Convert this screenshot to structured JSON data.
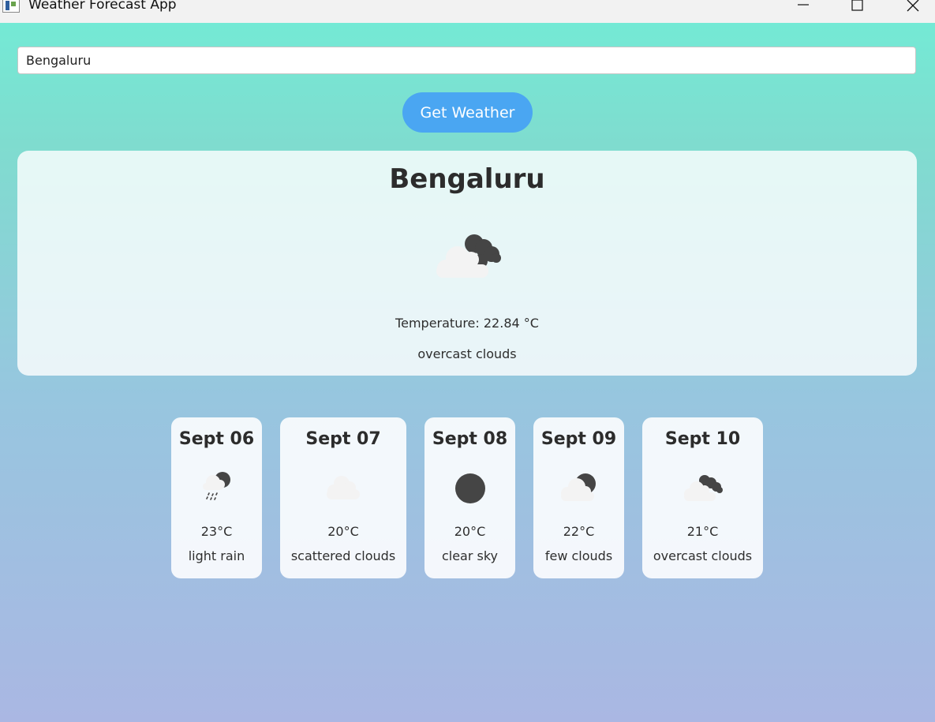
{
  "window": {
    "title": "Weather Forecast App",
    "controls": [
      "minimize-icon",
      "maximize-icon",
      "close-icon"
    ]
  },
  "search": {
    "value": "Bengaluru"
  },
  "button": {
    "label": "Get Weather",
    "color": "#4aa6f2"
  },
  "current": {
    "city": "Bengaluru",
    "icon": "overcast-clouds-icon",
    "temperature": "Temperature: 22.84 °C",
    "description": "overcast clouds"
  },
  "forecast": [
    {
      "date": "Sept 06",
      "temp": "23°C",
      "description": "light rain",
      "icon": "light-rain-icon"
    },
    {
      "date": "Sept 07",
      "temp": "20°C",
      "description": "scattered clouds",
      "icon": "scattered-clouds-icon"
    },
    {
      "date": "Sept 08",
      "temp": "20°C",
      "description": "clear sky",
      "icon": "clear-sky-icon"
    },
    {
      "date": "Sept 09",
      "temp": "22°C",
      "description": "few clouds",
      "icon": "few-clouds-icon"
    },
    {
      "date": "Sept 10",
      "temp": "21°C",
      "description": "overcast clouds",
      "icon": "overcast-clouds-icon"
    }
  ],
  "colors": {
    "background_top": "#72ecd6",
    "background_bottom": "#aab7e3",
    "icon_dark": "#454545",
    "icon_cloud": "#f3f3f3"
  }
}
